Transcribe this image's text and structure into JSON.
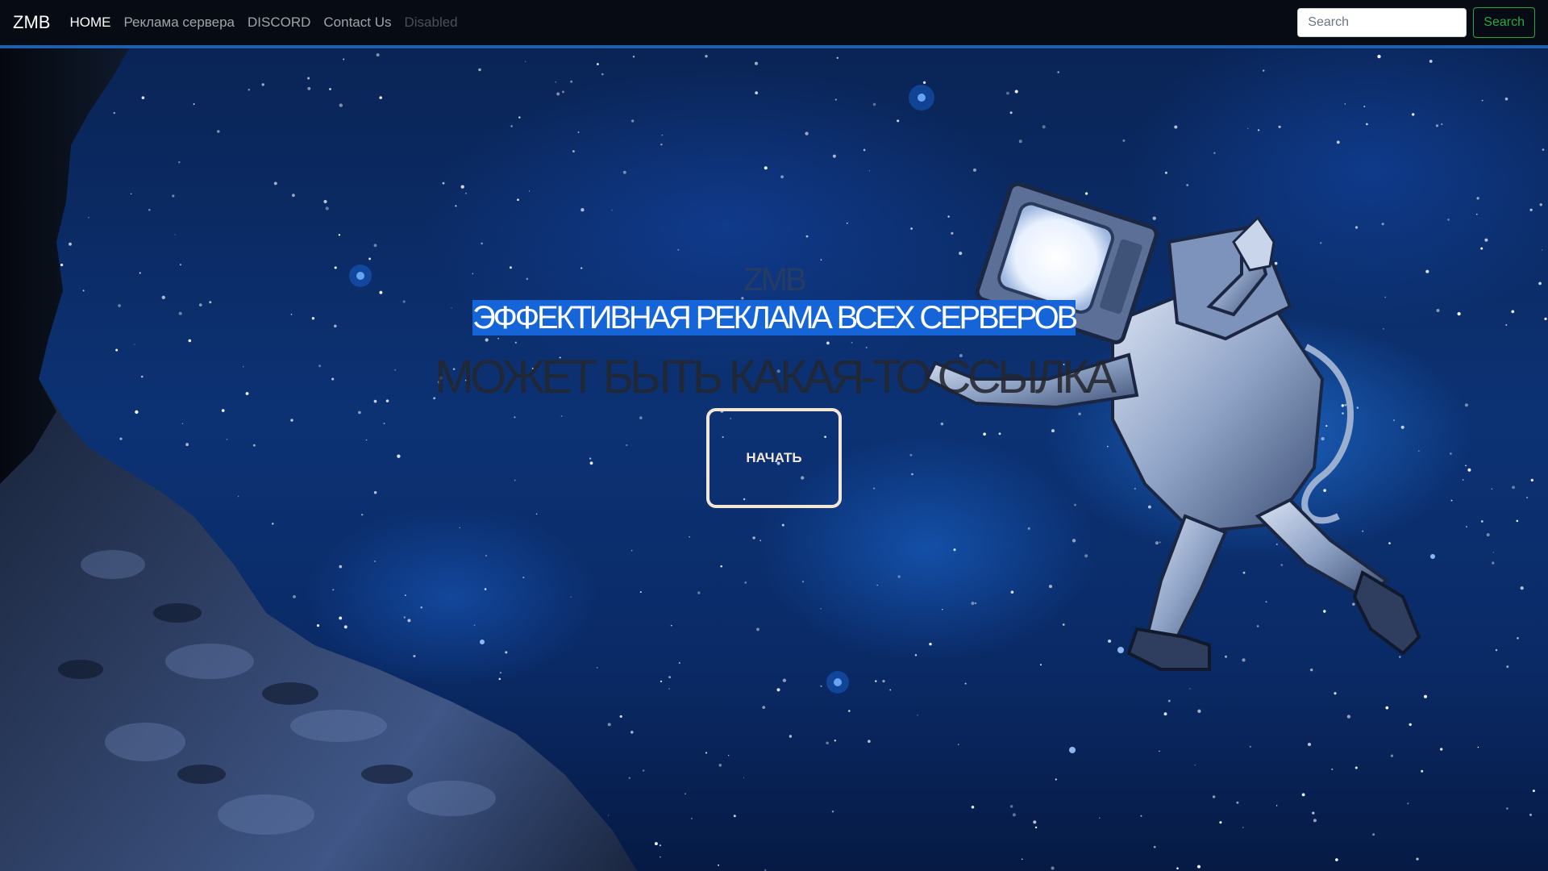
{
  "navbar": {
    "brand": "ZMB",
    "links": [
      {
        "label": "HOME",
        "state": "active"
      },
      {
        "label": "Реклама сервера",
        "state": "normal"
      },
      {
        "label": "DISCORD",
        "state": "normal"
      },
      {
        "label": "Contact Us",
        "state": "normal"
      },
      {
        "label": "Disabled",
        "state": "disabled"
      }
    ],
    "search": {
      "placeholder": "Search",
      "value": "",
      "button_label": "Search"
    }
  },
  "hero": {
    "small_heading": "ZMB",
    "title": "ЭФФЕКТИВНАЯ РЕКЛАМА ВСЕХ СЕРВЕРОВ",
    "subtitle": "МОЖЕТ БЫТЬ КАКАЯ-ТО ССЫЛКА",
    "button_label": "НАЧАТЬ"
  },
  "colors": {
    "navbar_bg": "#060b14",
    "navbar_border": "#1f5fb0",
    "title_highlight": "#1565d8",
    "search_button": "#28a745",
    "start_button_border": "#f3e6d3"
  },
  "icons": {
    "background": "space-nebula-image",
    "rock": "asteroid-rock-image",
    "figure": "astronaut-tv-head-image"
  }
}
